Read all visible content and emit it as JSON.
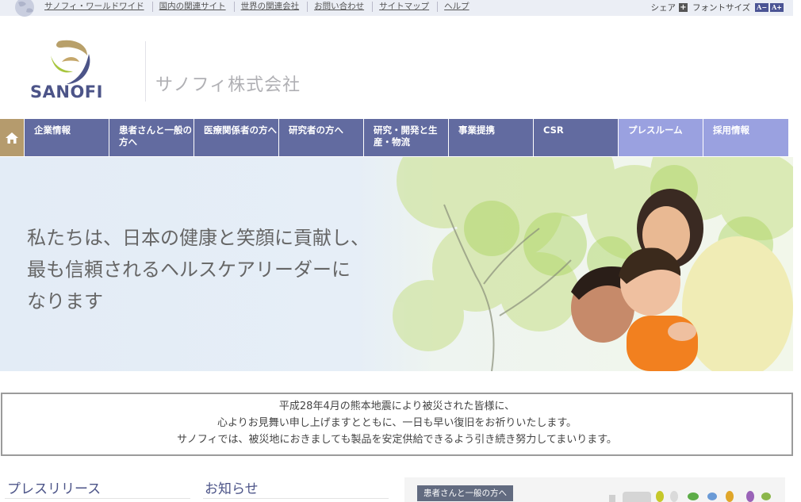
{
  "utility_nav": {
    "links": [
      "サノフィ・ワールドワイド",
      "国内の関連サイト",
      "世界の関連会社",
      "お問い合わせ",
      "サイトマップ",
      "ヘルプ"
    ],
    "share_label": "シェア",
    "fontsize_label": "フォントサイズ",
    "font_small": "A−",
    "font_large": "A+"
  },
  "header": {
    "logo_text": "SANOFI",
    "company_name": "サノフィ株式会社"
  },
  "main_nav": {
    "items": [
      {
        "label": "企業情報"
      },
      {
        "label": "患者さんと一般の方へ"
      },
      {
        "label": "医療関係者の方へ"
      },
      {
        "label": "研究者の方へ"
      },
      {
        "label": "研究・開発と生産・物流"
      },
      {
        "label": "事業提携"
      },
      {
        "label": "CSR"
      },
      {
        "label": "プレスルーム"
      },
      {
        "label": "採用情報"
      }
    ]
  },
  "hero": {
    "lines": [
      "私たちは、日本の健康と笑顔に貢献し、",
      "最も信頼されるヘルスケアリーダーに",
      "なります"
    ]
  },
  "notice": {
    "lines": [
      "平成28年4月の熊本地震により被災された皆様に、",
      "心よりお見舞い申し上げますとともに、一日も早い復旧をお祈りいたします。",
      "サノフィでは、被災地におきましても製品を安定供給できるよう引き続き努力してまいります。"
    ]
  },
  "sections": {
    "press_release": "プレスリリース",
    "news": "お知らせ",
    "patient_tag": "患者さんと一般の方へ"
  },
  "colors": {
    "nav_dark": "#626ba0",
    "nav_light": "#9aa1e0",
    "home_button": "#b59b6d",
    "brand": "#4c5488"
  }
}
